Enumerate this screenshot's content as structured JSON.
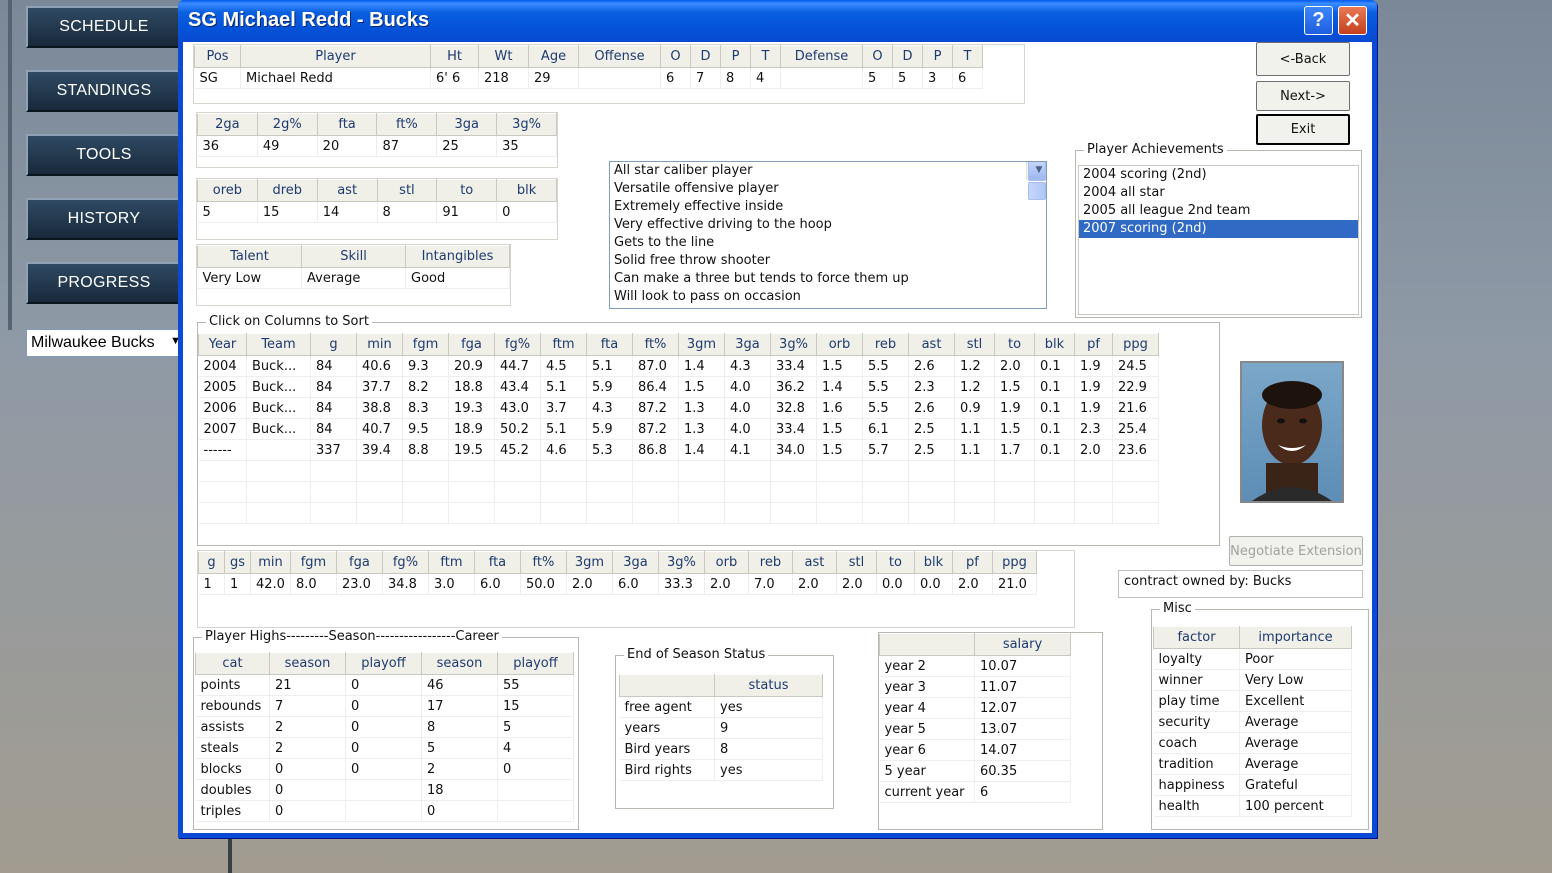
{
  "nav": {
    "items": [
      {
        "label": "SCHEDULE"
      },
      {
        "label": "STANDINGS"
      },
      {
        "label": "TOOLS"
      },
      {
        "label": "HISTORY"
      },
      {
        "label": "PROGRESS"
      }
    ],
    "team_select": "Milwaukee Bucks"
  },
  "window": {
    "title": "SG Michael Redd - Bucks",
    "help": "?",
    "close": "✕"
  },
  "buttons": {
    "back": "<-Back",
    "next": "Next->",
    "exit": "Exit",
    "negotiate": "Negotiate Extension"
  },
  "player_header": {
    "cols": [
      "Pos",
      "Player",
      "Ht",
      "Wt",
      "Age",
      "Offense",
      "O",
      "D",
      "P",
      "T",
      "Defense",
      "O",
      "D",
      "P",
      "T"
    ],
    "row": [
      "SG",
      "Michael Redd",
      "6' 6",
      "218",
      "29",
      "",
      "6",
      "7",
      "8",
      "4",
      "",
      "5",
      "5",
      "3",
      "6"
    ]
  },
  "shooting": {
    "cols": [
      "2ga",
      "2g%",
      "fta",
      "ft%",
      "3ga",
      "3g%"
    ],
    "row": [
      "36",
      "49",
      "20",
      "87",
      "25",
      "35"
    ]
  },
  "rebounding": {
    "cols": [
      "oreb",
      "dreb",
      "ast",
      "stl",
      "to",
      "blk"
    ],
    "row": [
      "5",
      "15",
      "14",
      "8",
      "91",
      "0"
    ]
  },
  "ratings": {
    "cols": [
      "Talent",
      "Skill",
      "Intangibles"
    ],
    "row": [
      "Very Low",
      "Average",
      "Good"
    ]
  },
  "scouting": [
    "All star caliber player",
    "Versatile offensive player",
    "Extremely effective inside",
    "Very effective driving to the hoop",
    "Gets to the line",
    "Solid free throw shooter",
    "Can make a three but tends to force them up",
    "Will look to pass on occasion"
  ],
  "achievements": {
    "label": "Player Achievements",
    "items": [
      "2004 scoring (2nd)",
      "2004 all star",
      "2005 all league 2nd team",
      "2007 scoring (2nd)"
    ],
    "selected": 3
  },
  "season_stats": {
    "label": "Click on Columns to Sort",
    "cols": [
      "Year",
      "Team",
      "g",
      "min",
      "fgm",
      "fga",
      "fg%",
      "ftm",
      "fta",
      "ft%",
      "3gm",
      "3ga",
      "3g%",
      "orb",
      "reb",
      "ast",
      "stl",
      "to",
      "blk",
      "pf",
      "ppg"
    ],
    "rows": [
      [
        "2004",
        "Buck...",
        "84",
        "40.6",
        "9.3",
        "20.9",
        "44.7",
        "4.5",
        "5.1",
        "87.0",
        "1.4",
        "4.3",
        "33.4",
        "1.5",
        "5.5",
        "2.6",
        "1.2",
        "2.0",
        "0.1",
        "1.9",
        "24.5"
      ],
      [
        "2005",
        "Buck...",
        "84",
        "37.7",
        "8.2",
        "18.8",
        "43.4",
        "5.1",
        "5.9",
        "86.4",
        "1.5",
        "4.0",
        "36.2",
        "1.4",
        "5.5",
        "2.3",
        "1.2",
        "1.5",
        "0.1",
        "1.9",
        "22.9"
      ],
      [
        "2006",
        "Buck...",
        "84",
        "38.8",
        "8.3",
        "19.3",
        "43.0",
        "3.7",
        "4.3",
        "87.2",
        "1.3",
        "4.0",
        "32.8",
        "1.6",
        "5.5",
        "2.6",
        "0.9",
        "1.9",
        "0.1",
        "1.9",
        "21.6"
      ],
      [
        "2007",
        "Buck...",
        "84",
        "40.7",
        "9.5",
        "18.9",
        "50.2",
        "5.1",
        "5.9",
        "87.2",
        "1.3",
        "4.0",
        "33.4",
        "1.5",
        "6.1",
        "2.5",
        "1.1",
        "1.5",
        "0.1",
        "2.3",
        "25.4"
      ],
      [
        "------",
        "",
        "337",
        "39.4",
        "8.8",
        "19.5",
        "45.2",
        "4.6",
        "5.3",
        "86.8",
        "1.4",
        "4.1",
        "34.0",
        "1.5",
        "5.7",
        "2.5",
        "1.1",
        "1.7",
        "0.1",
        "2.0",
        "23.6"
      ]
    ]
  },
  "game_stats": {
    "cols": [
      "g",
      "gs",
      "min",
      "fgm",
      "fga",
      "fg%",
      "ftm",
      "fta",
      "ft%",
      "3gm",
      "3ga",
      "3g%",
      "orb",
      "reb",
      "ast",
      "stl",
      "to",
      "blk",
      "pf",
      "ppg"
    ],
    "row": [
      "1",
      "1",
      "42.0",
      "8.0",
      "23.0",
      "34.8",
      "3.0",
      "6.0",
      "50.0",
      "2.0",
      "6.0",
      "33.3",
      "2.0",
      "7.0",
      "2.0",
      "2.0",
      "0.0",
      "0.0",
      "2.0",
      "21.0"
    ]
  },
  "contract_owner": "contract owned by: Bucks",
  "highs": {
    "label": "Player Highs---------Season-----------------Career",
    "cols": [
      "cat",
      "season",
      "playoff",
      "season",
      "playoff"
    ],
    "rows": [
      [
        "points",
        "21",
        "0",
        "46",
        "55"
      ],
      [
        "rebounds",
        "7",
        "0",
        "17",
        "15"
      ],
      [
        "assists",
        "2",
        "0",
        "8",
        "5"
      ],
      [
        "steals",
        "2",
        "0",
        "5",
        "4"
      ],
      [
        "blocks",
        "0",
        "0",
        "2",
        "0"
      ],
      [
        "doubles",
        "0",
        "",
        "18",
        ""
      ],
      [
        "triples",
        "0",
        "",
        "0",
        ""
      ]
    ]
  },
  "eos": {
    "label": "End of Season Status",
    "cols": [
      "",
      "status"
    ],
    "rows": [
      [
        "free agent",
        "yes"
      ],
      [
        "years",
        "9"
      ],
      [
        "Bird years",
        "8"
      ],
      [
        "Bird rights",
        "yes"
      ]
    ]
  },
  "salary": {
    "cols": [
      "",
      "salary"
    ],
    "rows": [
      [
        "year 2",
        "10.07"
      ],
      [
        "year 3",
        "11.07"
      ],
      [
        "year 4",
        "12.07"
      ],
      [
        "year 5",
        "13.07"
      ],
      [
        "year 6",
        "14.07"
      ],
      [
        "5 year",
        "60.35"
      ],
      [
        "current year",
        "6"
      ]
    ]
  },
  "misc": {
    "label": "Misc",
    "cols": [
      "factor",
      "importance"
    ],
    "rows": [
      [
        "loyalty",
        "Poor"
      ],
      [
        "winner",
        "Very Low"
      ],
      [
        "play time",
        "Excellent"
      ],
      [
        "security",
        "Average"
      ],
      [
        "coach",
        "Average"
      ],
      [
        "tradition",
        "Average"
      ],
      [
        "happiness",
        "Grateful"
      ],
      [
        "health",
        "100 percent"
      ]
    ]
  },
  "colors": {
    "title_bar": "#0a5fe0",
    "header_text": "#1e3a6e",
    "selection": "#316ac5"
  }
}
